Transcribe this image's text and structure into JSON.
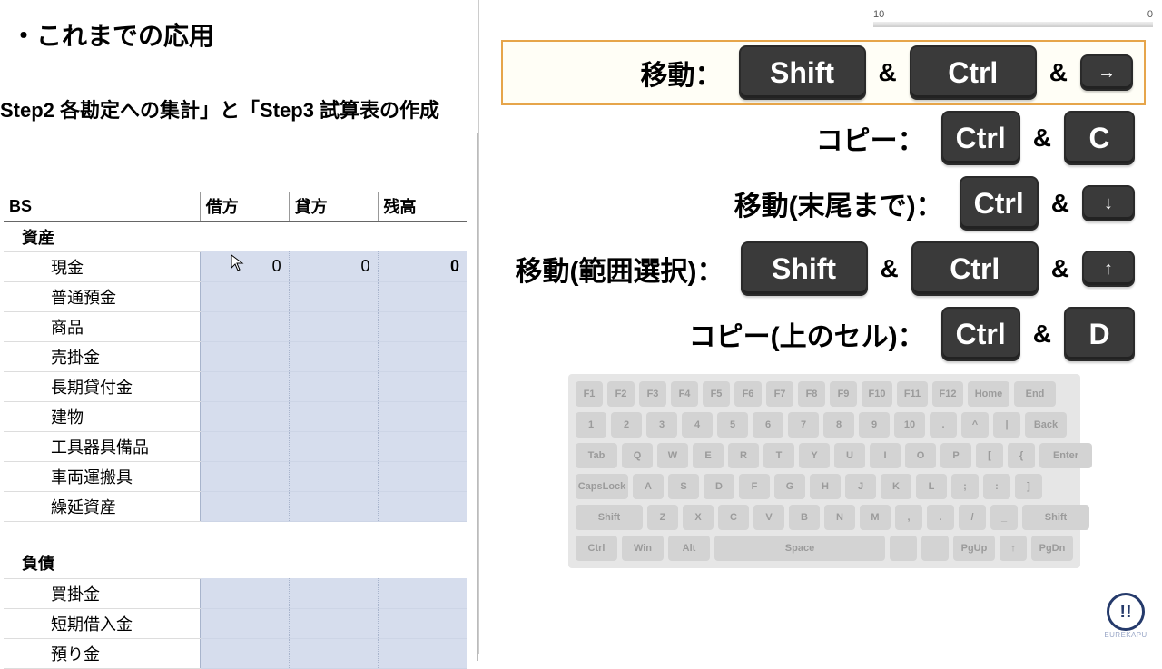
{
  "header": {
    "title": "・これまでの応用",
    "subtitle": "Step2 各勘定への集計」と「Step3 試算表の作成"
  },
  "bs": {
    "label": "BS",
    "columns": {
      "name": "",
      "debit": "借方",
      "credit": "貸方",
      "balance": "残高"
    },
    "sections": [
      {
        "title": "資産",
        "rows": [
          {
            "name": "現金",
            "debit": "0",
            "credit": "0",
            "balance": "0"
          },
          {
            "name": "普通預金",
            "debit": "",
            "credit": "",
            "balance": ""
          },
          {
            "name": "商品",
            "debit": "",
            "credit": "",
            "balance": ""
          },
          {
            "name": "売掛金",
            "debit": "",
            "credit": "",
            "balance": ""
          },
          {
            "name": "長期貸付金",
            "debit": "",
            "credit": "",
            "balance": ""
          },
          {
            "name": "建物",
            "debit": "",
            "credit": "",
            "balance": ""
          },
          {
            "name": "工具器具備品",
            "debit": "",
            "credit": "",
            "balance": ""
          },
          {
            "name": "車両運搬具",
            "debit": "",
            "credit": "",
            "balance": ""
          },
          {
            "name": "繰延資産",
            "debit": "",
            "credit": "",
            "balance": ""
          }
        ]
      },
      {
        "title": "負債",
        "rows": [
          {
            "name": "買掛金",
            "debit": "",
            "credit": "",
            "balance": ""
          },
          {
            "name": "短期借入金",
            "debit": "",
            "credit": "",
            "balance": ""
          },
          {
            "name": "預り金",
            "debit": "",
            "credit": "",
            "balance": ""
          }
        ]
      }
    ]
  },
  "ruler": {
    "left": "10",
    "right": "0"
  },
  "shortcuts": [
    {
      "label": "移動：",
      "keys": [
        "Shift",
        "Ctrl",
        "→"
      ],
      "highlight": true,
      "sizes": [
        "big",
        "big",
        "small"
      ]
    },
    {
      "label": "コピー：",
      "keys": [
        "Ctrl",
        "C"
      ],
      "highlight": false,
      "sizes": [
        "med",
        "med"
      ]
    },
    {
      "label": "移動(末尾まで)：",
      "keys": [
        "Ctrl",
        "↓"
      ],
      "highlight": false,
      "sizes": [
        "med",
        "small"
      ]
    },
    {
      "label": "移動(範囲選択)：",
      "keys": [
        "Shift",
        "Ctrl",
        "↑"
      ],
      "highlight": false,
      "sizes": [
        "big",
        "big",
        "small"
      ]
    },
    {
      "label": "コピー(上のセル)：",
      "keys": [
        "Ctrl",
        "D"
      ],
      "highlight": false,
      "sizes": [
        "med",
        "med"
      ]
    }
  ],
  "amp": "&",
  "keyboard": [
    [
      "F1",
      "F2",
      "F3",
      "F4",
      "F5",
      "F6",
      "F7",
      "F8",
      "F9",
      "F10",
      "F11",
      "F12",
      "Home",
      "End"
    ],
    [
      "1",
      "2",
      "3",
      "4",
      "5",
      "6",
      "7",
      "8",
      "9",
      "10",
      ".",
      "^",
      "|",
      "Back"
    ],
    [
      "Tab",
      "Q",
      "W",
      "E",
      "R",
      "T",
      "Y",
      "U",
      "I",
      "O",
      "P",
      "[",
      "{",
      "Enter"
    ],
    [
      "CapsLock",
      "A",
      "S",
      "D",
      "F",
      "G",
      "H",
      "J",
      "K",
      "L",
      ";",
      ":",
      "]"
    ],
    [
      "Shift",
      "Z",
      "X",
      "C",
      "V",
      "B",
      "N",
      "M",
      ",",
      ".",
      "/",
      "_",
      "Shift"
    ],
    [
      "Ctrl",
      "Win",
      "Alt",
      "Space",
      "",
      "",
      "PgUp",
      "↑",
      "PgDn"
    ]
  ],
  "logo": {
    "mark": "!!",
    "text": "EUREKAPU"
  }
}
